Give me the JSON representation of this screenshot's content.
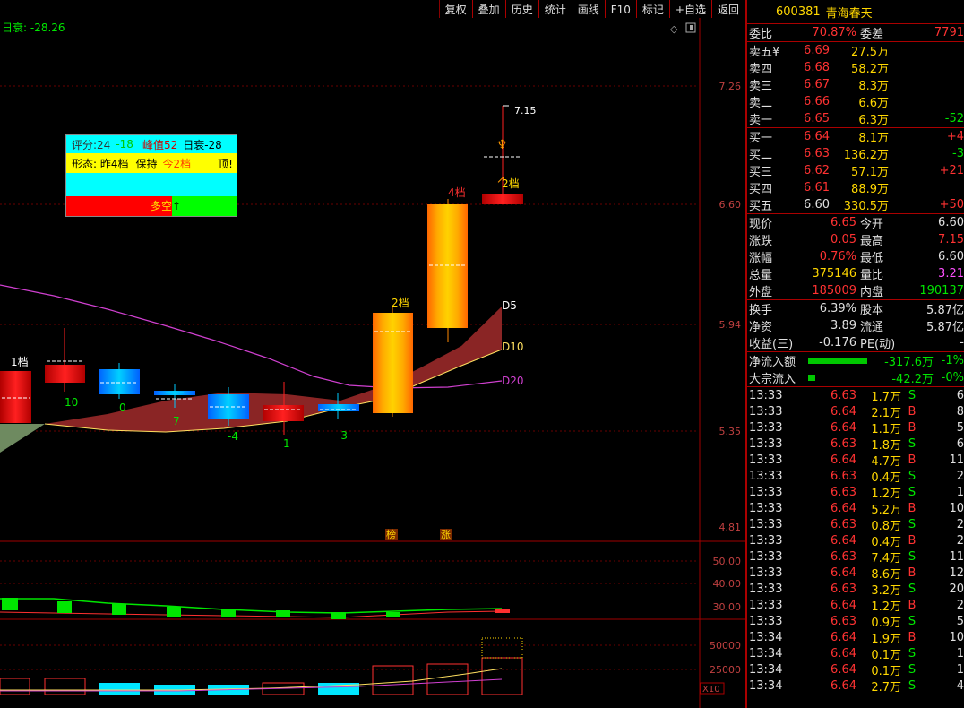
{
  "toolbar": {
    "items": [
      "复权",
      "叠加",
      "历史",
      "统计",
      "画线",
      "F10",
      "标记",
      "+自选",
      "返回"
    ]
  },
  "chart": {
    "daily_label": "日衰:",
    "daily_value": "-28.26",
    "price_axis": [
      "7.26",
      "6.60",
      "5.94",
      "5.35",
      "4.81"
    ],
    "ind_axis": [
      "50.00",
      "40.00",
      "30.00"
    ],
    "vol_axis": [
      "50000",
      "25000"
    ],
    "vol_unit": "X10",
    "high_marker": "7.15",
    "ma_labels": [
      "D5",
      "D10",
      "D20"
    ],
    "candle_labels": [
      "1档",
      "10",
      "0",
      "7",
      "-4",
      "1",
      "-3",
      "2档",
      "4档",
      "2档"
    ],
    "bottom_tags": [
      "榜",
      "涨"
    ],
    "colors": {
      "up": "#ff0000",
      "down": "#00aaff",
      "ma5": "#a03030",
      "ma20": "#d040d0",
      "grid": "#7a0000"
    }
  },
  "legend_box": {
    "row1": {
      "a": "评分:24",
      "b": "-18",
      "c": "峰值52",
      "d": "日衰-28"
    },
    "row2": {
      "a": "形态: 昨4档",
      "b": "保持",
      "c": "今2档",
      "d": "顶!"
    },
    "row4": {
      "a": "多空",
      "b": "↑"
    }
  },
  "quote": {
    "code": "600381",
    "name": "青海春天",
    "weibi_label": "委比",
    "weibi_value": "70.87%",
    "weicha_label": "委差",
    "weicha_value": "7791",
    "sells": [
      {
        "label": "卖五",
        "mark": "¥",
        "price": "6.69",
        "vol": "27.5万",
        "chg": ""
      },
      {
        "label": "卖四",
        "mark": "",
        "price": "6.68",
        "vol": "58.2万",
        "chg": ""
      },
      {
        "label": "卖三",
        "mark": "",
        "price": "6.67",
        "vol": "8.3万",
        "chg": ""
      },
      {
        "label": "卖二",
        "mark": "",
        "price": "6.66",
        "vol": "6.6万",
        "chg": ""
      },
      {
        "label": "卖一",
        "mark": "",
        "price": "6.65",
        "vol": "6.3万",
        "chg": "-52"
      }
    ],
    "buys": [
      {
        "label": "买一",
        "price": "6.64",
        "vol": "8.1万",
        "chg": "+4"
      },
      {
        "label": "买二",
        "price": "6.63",
        "vol": "136.2万",
        "chg": "-3"
      },
      {
        "label": "买三",
        "price": "6.62",
        "vol": "57.1万",
        "chg": "+21"
      },
      {
        "label": "买四",
        "price": "6.61",
        "vol": "88.9万",
        "chg": ""
      },
      {
        "label": "买五",
        "price": "6.60",
        "vol": "330.5万",
        "chg": "+50"
      }
    ],
    "stats": [
      {
        "l1": "现价",
        "v1": "6.65",
        "c1": "red",
        "l2": "今开",
        "v2": "6.60",
        "c2": "white"
      },
      {
        "l1": "涨跌",
        "v1": "0.05",
        "c1": "red",
        "l2": "最高",
        "v2": "7.15",
        "c2": "red"
      },
      {
        "l1": "涨幅",
        "v1": "0.76%",
        "c1": "red",
        "l2": "最低",
        "v2": "6.60",
        "c2": "white"
      },
      {
        "l1": "总量",
        "v1": "375146",
        "c1": "yellow",
        "l2": "量比",
        "v2": "3.21",
        "c2": "magenta"
      },
      {
        "l1": "外盘",
        "v1": "185009",
        "c1": "red",
        "l2": "内盘",
        "v2": "190137",
        "c2": "green"
      }
    ],
    "stats2": [
      {
        "l1": "换手",
        "v1": "6.39%",
        "l2": "股本",
        "v2": "5.87亿"
      },
      {
        "l1": "净资",
        "v1": "3.89",
        "l2": "流通",
        "v2": "5.87亿"
      },
      {
        "l1": "收益(三)",
        "v1": "-0.176",
        "l2": "PE(动)",
        "v2": "-"
      }
    ],
    "flows": [
      {
        "label": "净流入额",
        "bar": 66,
        "value": "-317.6万",
        "pct": "-1%"
      },
      {
        "label": "大宗流入",
        "bar": 8,
        "value": "-42.2万",
        "pct": "-0%"
      }
    ],
    "ticks": [
      {
        "t": "13:33",
        "p": "6.63",
        "v": "1.7万",
        "bs": "S",
        "n": "6"
      },
      {
        "t": "13:33",
        "p": "6.64",
        "v": "2.1万",
        "bs": "B",
        "n": "8"
      },
      {
        "t": "13:33",
        "p": "6.64",
        "v": "1.1万",
        "bs": "B",
        "n": "5"
      },
      {
        "t": "13:33",
        "p": "6.63",
        "v": "1.8万",
        "bs": "S",
        "n": "6"
      },
      {
        "t": "13:33",
        "p": "6.64",
        "v": "4.7万",
        "bs": "B",
        "n": "11"
      },
      {
        "t": "13:33",
        "p": "6.63",
        "v": "0.4万",
        "bs": "S",
        "n": "2"
      },
      {
        "t": "13:33",
        "p": "6.63",
        "v": "1.2万",
        "bs": "S",
        "n": "1"
      },
      {
        "t": "13:33",
        "p": "6.64",
        "v": "5.2万",
        "bs": "B",
        "n": "10"
      },
      {
        "t": "13:33",
        "p": "6.63",
        "v": "0.8万",
        "bs": "S",
        "n": "2"
      },
      {
        "t": "13:33",
        "p": "6.64",
        "v": "0.4万",
        "bs": "B",
        "n": "2"
      },
      {
        "t": "13:33",
        "p": "6.63",
        "v": "7.4万",
        "bs": "S",
        "n": "11"
      },
      {
        "t": "13:33",
        "p": "6.64",
        "v": "8.6万",
        "bs": "B",
        "n": "12"
      },
      {
        "t": "13:33",
        "p": "6.63",
        "v": "3.2万",
        "bs": "S",
        "n": "20"
      },
      {
        "t": "13:33",
        "p": "6.64",
        "v": "1.2万",
        "bs": "B",
        "n": "2"
      },
      {
        "t": "13:33",
        "p": "6.63",
        "v": "0.9万",
        "bs": "S",
        "n": "5"
      },
      {
        "t": "13:34",
        "p": "6.64",
        "v": "1.9万",
        "bs": "B",
        "n": "10"
      },
      {
        "t": "13:34",
        "p": "6.64",
        "v": "0.1万",
        "bs": "S",
        "n": "1"
      },
      {
        "t": "13:34",
        "p": "6.64",
        "v": "0.1万",
        "bs": "S",
        "n": "1"
      },
      {
        "t": "13:34",
        "p": "6.64",
        "v": "2.7万",
        "bs": "S",
        "n": "4"
      }
    ]
  }
}
